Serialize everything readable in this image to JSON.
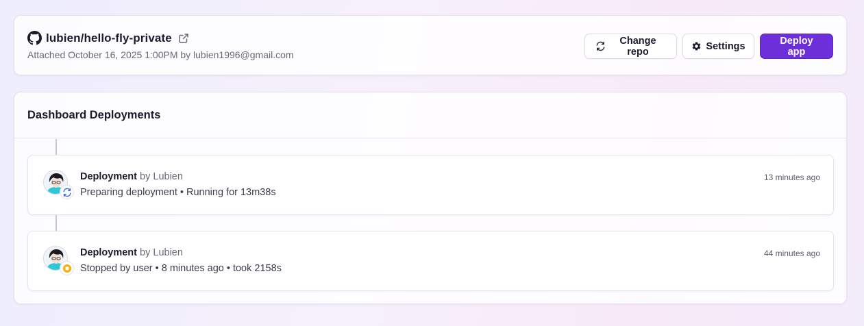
{
  "repo": {
    "name": "lubien/hello-fly-private",
    "attached": "Attached October 16, 2025 1:00PM by lubien1996@gmail.com"
  },
  "actions": {
    "change_repo": "Change repo",
    "settings": "Settings",
    "deploy": "Deploy app"
  },
  "deployments": {
    "title": "Dashboard Deployments",
    "items": [
      {
        "label": "Deployment",
        "by": "by Lubien",
        "status": "Preparing deployment • Running for 13m38s",
        "time": "13 minutes ago",
        "status_icon": "sync-icon"
      },
      {
        "label": "Deployment",
        "by": "by Lubien",
        "status": "Stopped by user • 8 minutes ago • took 2158s",
        "time": "44 minutes ago",
        "status_icon": "stop-icon"
      }
    ]
  },
  "colors": {
    "primary": "#6d2fd9",
    "sync": "#3b6fe0",
    "stopped": "#f2b31a"
  }
}
